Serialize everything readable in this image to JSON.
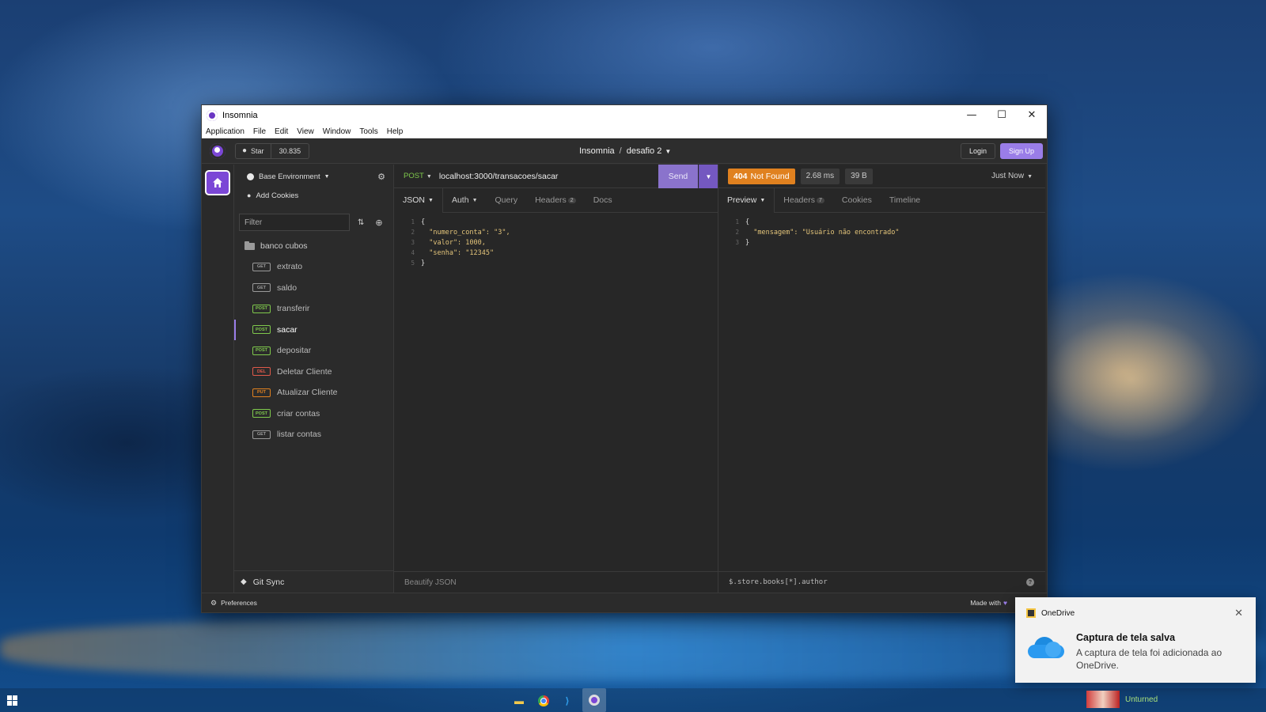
{
  "window": {
    "title": "Insomnia",
    "controls": {
      "minimize": "—",
      "maximize": "☐",
      "close": "✕"
    }
  },
  "menubar": [
    "Application",
    "File",
    "Edit",
    "View",
    "Window",
    "Tools",
    "Help"
  ],
  "topbar": {
    "star_label": "Star",
    "star_count": "30.835",
    "breadcrumb_root": "Insomnia",
    "breadcrumb_sep": "/",
    "breadcrumb_current": "desafio 2",
    "login_label": "Login",
    "signup_label": "Sign Up"
  },
  "sidebar": {
    "environment": "Base Environment",
    "add_cookies": "Add Cookies",
    "filter_placeholder": "Filter",
    "folder": "banco cubos",
    "items": [
      {
        "method": "GET",
        "name": "extrato",
        "color": "#9a9a9a"
      },
      {
        "method": "GET",
        "name": "saldo",
        "color": "#9a9a9a"
      },
      {
        "method": "POST",
        "name": "transferir",
        "color": "#7fc94c"
      },
      {
        "method": "POST",
        "name": "sacar",
        "color": "#7fc94c",
        "active": true
      },
      {
        "method": "POST",
        "name": "depositar",
        "color": "#7fc94c"
      },
      {
        "method": "DEL",
        "name": "Deletar Cliente",
        "color": "#e05a4a"
      },
      {
        "method": "PUT",
        "name": "Atualizar Cliente",
        "color": "#e0811f"
      },
      {
        "method": "POST",
        "name": "criar contas",
        "color": "#7fc94c"
      },
      {
        "method": "GET",
        "name": "listar contas",
        "color": "#9a9a9a"
      }
    ],
    "git_sync": "Git Sync"
  },
  "request": {
    "method": "POST",
    "url": "localhost:3000/transacoes/sacar",
    "send_label": "Send",
    "tabs": {
      "body": "JSON",
      "auth": "Auth",
      "query": "Query",
      "headers": "Headers",
      "headers_count": "2",
      "docs": "Docs"
    },
    "body_lines": [
      {
        "n": "1",
        "text": "{"
      },
      {
        "n": "2",
        "text": "  \"numero_conta\": \"3\","
      },
      {
        "n": "3",
        "text": "  \"valor\": 1000,"
      },
      {
        "n": "4",
        "text": "  \"senha\": \"12345\""
      },
      {
        "n": "5",
        "text": "}"
      }
    ],
    "beautify_label": "Beautify JSON"
  },
  "response": {
    "status_code": "404",
    "status_text": "Not Found",
    "time": "2.68 ms",
    "size": "39 B",
    "timestamp": "Just Now",
    "tabs": {
      "preview": "Preview",
      "headers": "Headers",
      "headers_count": "7",
      "cookies": "Cookies",
      "timeline": "Timeline"
    },
    "body_lines": [
      {
        "n": "1",
        "text": "{"
      },
      {
        "n": "2",
        "text": "  \"mensagem\": \"Usuário não encontrado\""
      },
      {
        "n": "3",
        "text": "}"
      }
    ],
    "filter_placeholder": "$.store.books[*].author"
  },
  "statusbar": {
    "preferences": "Preferences",
    "made_with": "Made with"
  },
  "toast": {
    "app": "OneDrive",
    "title": "Captura de tela salva",
    "body": "A captura de tela foi adicionada ao OneDrive."
  },
  "taskbar": {
    "game_name": "Unturned"
  },
  "colors": {
    "accent": "#7b47d6",
    "send": "#8a73cc",
    "status_404": "#e0811f",
    "post": "#7fc94c"
  }
}
